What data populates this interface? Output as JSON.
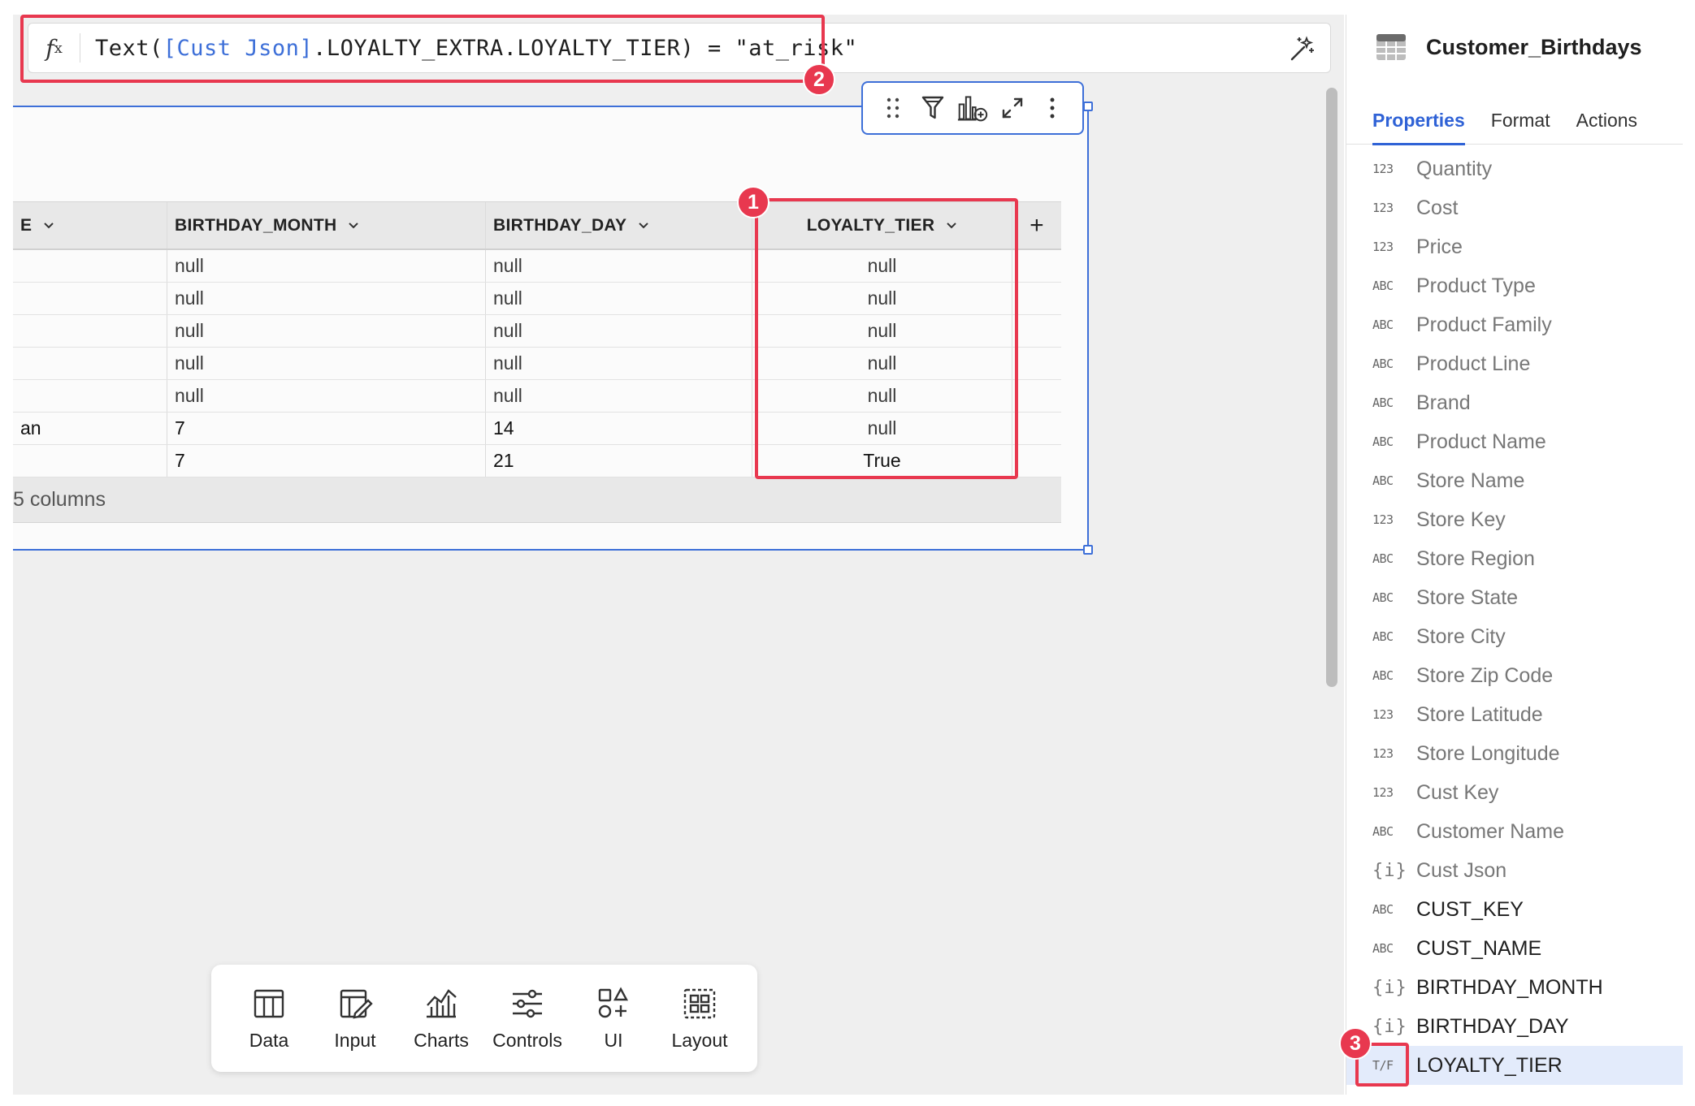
{
  "formula": {
    "prefix": "Text(",
    "ref": "[Cust Json]",
    "suffix": ".LOYALTY_EXTRA.LOYALTY_TIER) = \"at_risk\""
  },
  "table": {
    "columns": [
      "E",
      "BIRTHDAY_MONTH",
      "BIRTHDAY_DAY",
      "LOYALTY_TIER"
    ],
    "add_column_label": "+",
    "rows": [
      [
        "",
        "null",
        "null",
        "null"
      ],
      [
        "",
        "null",
        "null",
        "null"
      ],
      [
        "",
        "null",
        "null",
        "null"
      ],
      [
        "",
        "null",
        "null",
        "null"
      ],
      [
        "",
        "null",
        "null",
        "null"
      ],
      [
        "an",
        "7",
        "14",
        "null"
      ],
      [
        "",
        "7",
        "21",
        "True"
      ]
    ],
    "footer": "5 columns"
  },
  "dock": {
    "items": [
      {
        "label": "Data",
        "icon": "table-icon"
      },
      {
        "label": "Input",
        "icon": "input-icon"
      },
      {
        "label": "Charts",
        "icon": "charts-icon"
      },
      {
        "label": "Controls",
        "icon": "controls-icon"
      },
      {
        "label": "UI",
        "icon": "ui-icon"
      },
      {
        "label": "Layout",
        "icon": "layout-icon"
      }
    ]
  },
  "panel": {
    "title": "Customer_Birthdays",
    "tabs": [
      "Properties",
      "Format",
      "Actions"
    ],
    "active_tab": "Properties",
    "columns": [
      {
        "type": "123",
        "name": "Quantity",
        "dark": false
      },
      {
        "type": "123",
        "name": "Cost",
        "dark": false
      },
      {
        "type": "123",
        "name": "Price",
        "dark": false
      },
      {
        "type": "ABC",
        "name": "Product Type",
        "dark": false
      },
      {
        "type": "ABC",
        "name": "Product Family",
        "dark": false
      },
      {
        "type": "ABC",
        "name": "Product Line",
        "dark": false
      },
      {
        "type": "ABC",
        "name": "Brand",
        "dark": false
      },
      {
        "type": "ABC",
        "name": "Product Name",
        "dark": false
      },
      {
        "type": "ABC",
        "name": "Store Name",
        "dark": false
      },
      {
        "type": "123",
        "name": "Store Key",
        "dark": false
      },
      {
        "type": "ABC",
        "name": "Store Region",
        "dark": false
      },
      {
        "type": "ABC",
        "name": "Store State",
        "dark": false
      },
      {
        "type": "ABC",
        "name": "Store City",
        "dark": false
      },
      {
        "type": "ABC",
        "name": "Store Zip Code",
        "dark": false
      },
      {
        "type": "123",
        "name": "Store Latitude",
        "dark": false
      },
      {
        "type": "123",
        "name": "Store Longitude",
        "dark": false
      },
      {
        "type": "123",
        "name": "Cust Key",
        "dark": false
      },
      {
        "type": "ABC",
        "name": "Customer Name",
        "dark": false
      },
      {
        "type": "{i}",
        "name": "Cust Json",
        "dark": false
      },
      {
        "type": "ABC",
        "name": "CUST_KEY",
        "dark": true
      },
      {
        "type": "ABC",
        "name": "CUST_NAME",
        "dark": true
      },
      {
        "type": "{i}",
        "name": "BIRTHDAY_MONTH",
        "dark": true
      },
      {
        "type": "{i}",
        "name": "BIRTHDAY_DAY",
        "dark": true
      },
      {
        "type": "T/F",
        "name": "LOYALTY_TIER",
        "dark": true,
        "selected": true
      }
    ]
  },
  "annotations": [
    "1",
    "2",
    "3"
  ],
  "colors": {
    "accent": "#2f62d6",
    "annotation": "#e8384f",
    "selection_border": "#3d6fd8"
  }
}
